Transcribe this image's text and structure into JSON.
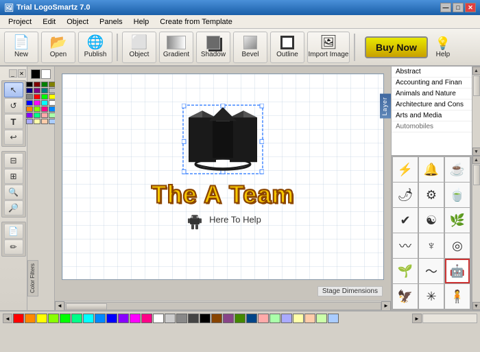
{
  "titleBar": {
    "title": "Trial LogoSmartz 7.0",
    "icon": "🖼",
    "controls": [
      "—",
      "□",
      "✕"
    ]
  },
  "menuBar": {
    "items": [
      "Project",
      "Edit",
      "Object",
      "Panels",
      "Help",
      "Create from Template"
    ]
  },
  "toolbar": {
    "buttons": [
      {
        "id": "new",
        "label": "New",
        "icon": "📄"
      },
      {
        "id": "open",
        "label": "Open",
        "icon": "📂"
      },
      {
        "id": "publish",
        "label": "Publish",
        "icon": "🌐"
      },
      {
        "id": "object",
        "label": "Object",
        "icon": "⬜"
      },
      {
        "id": "gradient",
        "label": "Gradient",
        "icon": "▦"
      },
      {
        "id": "shadow",
        "label": "Shadow",
        "icon": "◼"
      },
      {
        "id": "bevel",
        "label": "Bevel",
        "icon": "⬛"
      },
      {
        "id": "outline",
        "label": "Outline",
        "icon": "▢"
      },
      {
        "id": "import-image",
        "label": "Import Image",
        "icon": "🖼"
      }
    ],
    "buyNow": "Buy Now",
    "help": "Help"
  },
  "leftTools": {
    "group1": [
      "↖",
      "↺",
      "T",
      "↩",
      "⊟",
      "⊞",
      "🔍",
      "🔎"
    ],
    "group2": [
      "📄",
      "✏️"
    ]
  },
  "canvas": {
    "stageDimensions": "Stage Dimensions",
    "layerTab": "Layer"
  },
  "logo": {
    "mainText": "The A Team",
    "subText": "Here To Help"
  },
  "rightPanel": {
    "categories": [
      "Abstract",
      "Accounting and Finan",
      "Animals and Nature",
      "Architecture and Cons",
      "Arts and Media",
      "Automobiles"
    ],
    "icons": [
      {
        "symbol": "⚡",
        "selected": false
      },
      {
        "symbol": "🔔",
        "selected": false
      },
      {
        "symbol": "☕",
        "selected": false
      },
      {
        "symbol": "🌶",
        "selected": false
      },
      {
        "symbol": "⚙",
        "selected": false
      },
      {
        "symbol": "🍵",
        "selected": false
      },
      {
        "symbol": "✔",
        "selected": false
      },
      {
        "symbol": "☯",
        "selected": false
      },
      {
        "symbol": "🌿",
        "selected": false
      },
      {
        "symbol": "〰",
        "selected": false
      },
      {
        "symbol": "⚲",
        "selected": false
      },
      {
        "symbol": "◎",
        "selected": false
      },
      {
        "symbol": "🌱",
        "selected": false
      },
      {
        "symbol": "〜",
        "selected": false
      },
      {
        "symbol": "🤖",
        "selected": true
      },
      {
        "symbol": "🦅",
        "selected": false
      },
      {
        "symbol": "✳",
        "selected": false
      },
      {
        "symbol": "🧍",
        "selected": false
      }
    ]
  },
  "colorPanel": {
    "label": "Color Filters",
    "swatches": [
      "#000000",
      "#ffffff",
      "#808080",
      "#c0c0c0",
      "#ff0000",
      "#00ff00",
      "#0000ff",
      "#ffff00",
      "#ff8800",
      "#ff00ff",
      "#00ffff",
      "#880000",
      "#008800",
      "#000088",
      "#884400",
      "#448800",
      "#004488",
      "#884488",
      "#448888",
      "#888844",
      "#ffaaaa",
      "#aaffaa",
      "#aaaaff",
      "#ffffaa",
      "#ffccaa",
      "#ffaaff",
      "#aaffff",
      "#ccaaff"
    ]
  },
  "bottomBar": {
    "colors": [
      "#ff0000",
      "#ff8800",
      "#ffff00",
      "#88ff00",
      "#00ff00",
      "#00ff88",
      "#00ffff",
      "#0088ff",
      "#0000ff",
      "#8800ff",
      "#ff00ff",
      "#ff0088",
      "#ffffff",
      "#cccccc",
      "#888888",
      "#444444",
      "#000000",
      "#884400",
      "#884488",
      "#448800",
      "#004488",
      "#ffaaaa",
      "#aaffaa",
      "#aaaaff",
      "#ffffaa",
      "#ffccaa",
      "#ccffaa",
      "#aaccff"
    ]
  },
  "statusBar": {
    "value": ""
  }
}
